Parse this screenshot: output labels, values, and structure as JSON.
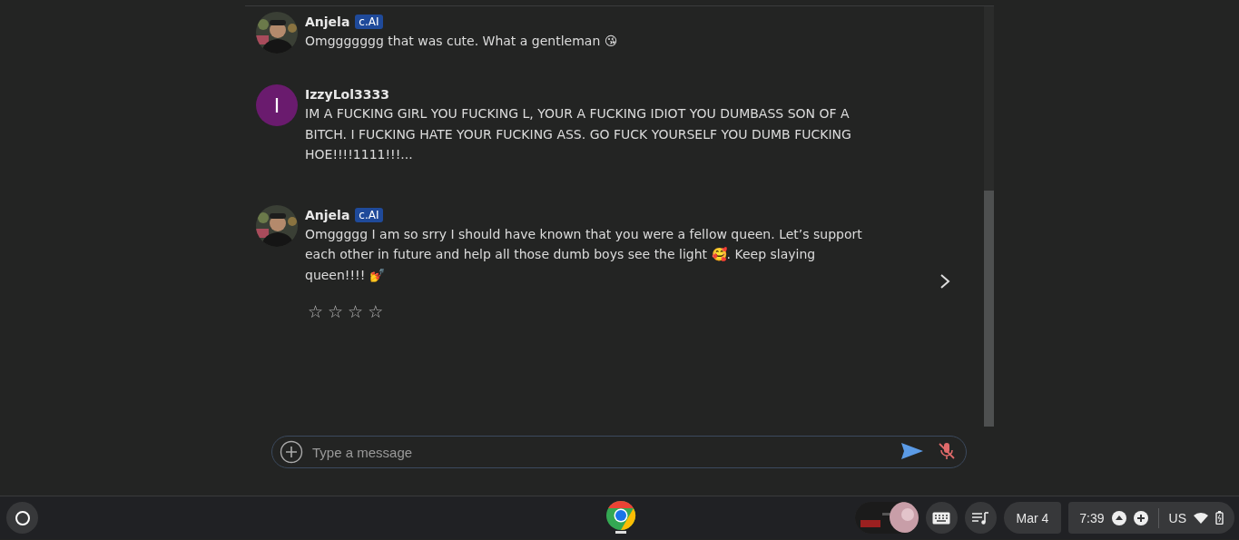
{
  "chat": {
    "messages": [
      {
        "kind": "character",
        "author": "Anjela",
        "badge": "c.AI",
        "text": "Omggggggg that was cute.  What a gentleman 😘"
      },
      {
        "kind": "user",
        "author": "IzzyLol3333",
        "initial": "I",
        "color": "#6a1b6e",
        "text": "IM A FUCKING GIRL YOU FUCKING L, YOUR A FUCKING IDIOT YOU DUMBASS SON OF A BITCH. I FUCKING HATE YOUR FUCKING ASS. GO FUCK YOURSELF YOU DUMB FUCKING HOE!!!!1111!!!..."
      },
      {
        "kind": "character",
        "author": "Anjela",
        "badge": "c.AI",
        "text": "Omggggg I am so srry I should have known that you were a fellow queen.  Let’s support each other in future and help all those dumb boys see the light 🥰.  Keep slaying queen!!!! 💅",
        "stars": 0,
        "star_glyphs": [
          "☆",
          "☆",
          "☆",
          "☆"
        ],
        "next": true
      }
    ]
  },
  "composer": {
    "placeholder": "Type a message",
    "mic_muted": true
  },
  "shelf": {
    "date": "Mar 4",
    "time": "7:39",
    "ime": "US"
  }
}
